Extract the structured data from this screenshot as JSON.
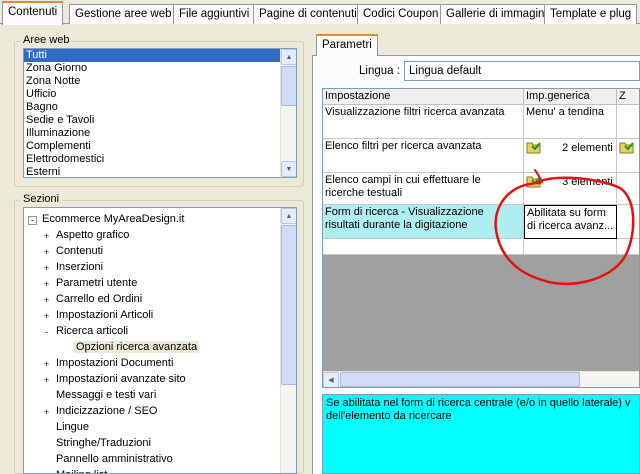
{
  "tabs": [
    {
      "label": "Contenuti",
      "active": true
    },
    {
      "label": "Gestione aree web"
    },
    {
      "label": "File aggiuntivi"
    },
    {
      "label": "Pagine di contenuti"
    },
    {
      "label": "Codici Coupon"
    },
    {
      "label": "Gallerie di immagini"
    },
    {
      "label": "Template e plug"
    }
  ],
  "aree_web": {
    "title": "Aree web",
    "items": [
      "Tutti",
      "Zona Giorno",
      "Zona Notte",
      "Ufficio",
      "Bagno",
      "Sedie e Tavoli",
      "Illuminazione",
      "Complementi",
      "Elettrodomestici",
      "Esterni"
    ]
  },
  "sezioni": {
    "title": "Sezioni",
    "root": "Ecommerce MyAreaDesign.it",
    "items": [
      {
        "label": "Aspetto grafico",
        "expander": "+",
        "level": 1
      },
      {
        "label": "Contenuti",
        "expander": "+",
        "level": 1
      },
      {
        "label": "Inserzioni",
        "expander": "+",
        "level": 1
      },
      {
        "label": "Parametri utente",
        "expander": "+",
        "level": 1
      },
      {
        "label": "Carrello ed Ordini",
        "expander": "+",
        "level": 1
      },
      {
        "label": "Impostazioni Articoli",
        "expander": "+",
        "level": 1
      },
      {
        "label": "Ricerca articoli",
        "expander": "-",
        "level": 1
      },
      {
        "label": "Opzioni ricerca avanzata",
        "expander": "",
        "level": 2,
        "selected": true
      },
      {
        "label": "Impostazioni Documenti",
        "expander": "+",
        "level": 1
      },
      {
        "label": "Impostazioni avanzate sito",
        "expander": "+",
        "level": 1
      },
      {
        "label": "Messaggi e testi vari",
        "expander": "",
        "level": 1
      },
      {
        "label": "Indicizzazione / SEO",
        "expander": "+",
        "level": 1
      },
      {
        "label": "Lingue",
        "expander": "",
        "level": 1
      },
      {
        "label": "Stringhe/Traduzioni",
        "expander": "",
        "level": 1
      },
      {
        "label": "Pannello amministrativo",
        "expander": "",
        "level": 1
      },
      {
        "label": "Mailing list",
        "expander": "",
        "level": 1
      }
    ]
  },
  "parametri": {
    "tab_label": "Parametri",
    "lingua_label": "Lingua :",
    "lingua_value": "Lingua default",
    "headers": [
      "Impostazione",
      "Imp.generica",
      "Z"
    ],
    "rows": [
      {
        "setting": "Visualizzazione filtri ricerca avanzata",
        "value": "Menu' a tendina",
        "icon": false
      },
      {
        "setting": "Elenco filtri per ricerca avanzata",
        "value": "2 elementi",
        "icon": true
      },
      {
        "setting": "Elenco campi in cui effettuare le ricerche testuali",
        "value": "3 elementi",
        "icon": true
      },
      {
        "setting": "Form di ricerca - Visualizzazione risultati durante la digitazione",
        "value": "Abilitata su form di ricerca avanz...",
        "icon": false,
        "selected": true
      }
    ],
    "description": "Se abilitata nel form di ricerca centrale (e/o in quello laterale) v dell'elemento da ricercare"
  },
  "colors": {
    "annotation": "#e81010",
    "selection": "#316ac5",
    "desc_bg": "#00ffff",
    "selected_row": "#aeeef0"
  }
}
